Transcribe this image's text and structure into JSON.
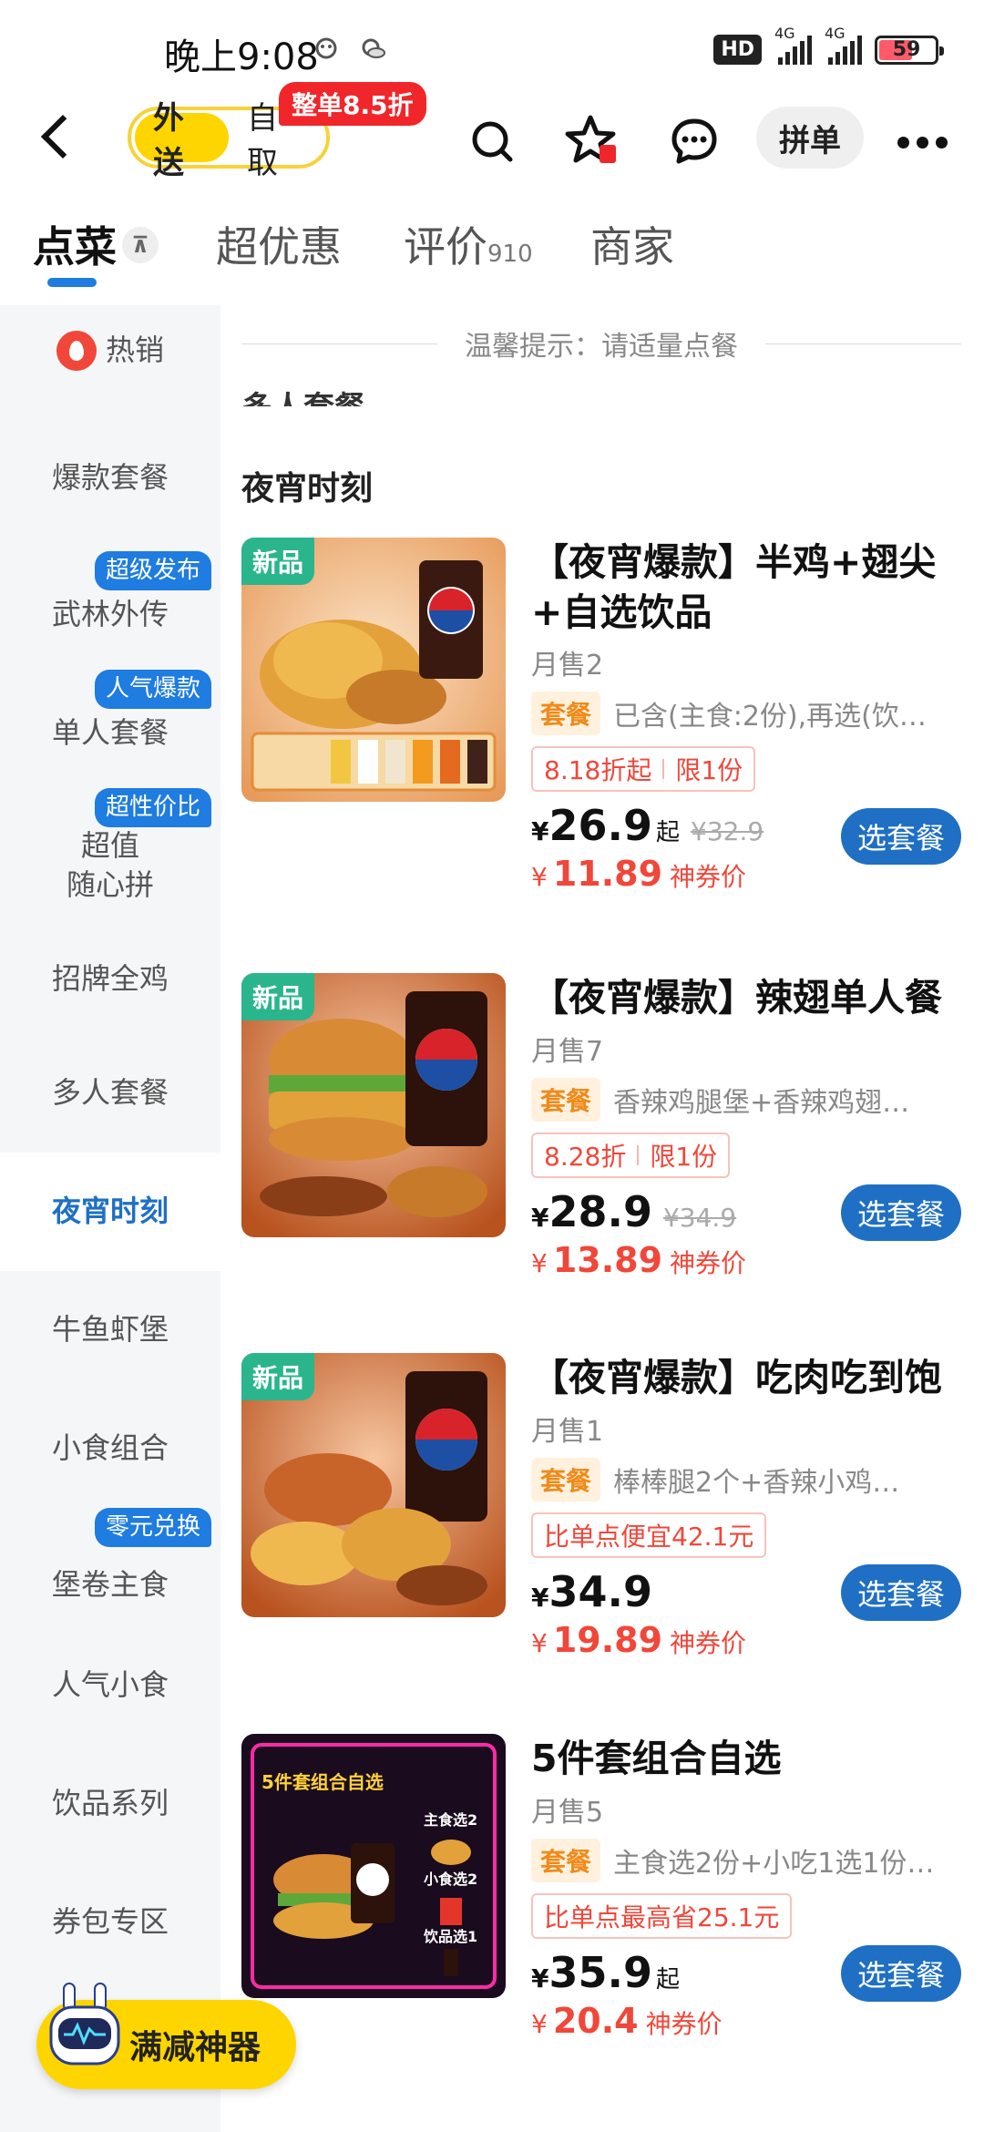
{
  "status_bar": {
    "time": "晚上9:08",
    "hd": "HD",
    "signal_1": "4G",
    "signal_2": "4G",
    "battery": "59"
  },
  "nav": {
    "delivery": "外送",
    "pickup": "自取",
    "promo_badge": "整单8.5折",
    "group_order": "拼单"
  },
  "tabs": [
    {
      "label": "点菜",
      "sub": ""
    },
    {
      "label": "超优惠",
      "sub": ""
    },
    {
      "label": "评价",
      "sub": "910"
    },
    {
      "label": "商家",
      "sub": ""
    }
  ],
  "sidebar": {
    "items": [
      {
        "label": "热销",
        "tag": ""
      },
      {
        "label": "爆款套餐",
        "tag": ""
      },
      {
        "label": "武林外传",
        "tag": "超级发布"
      },
      {
        "label": "单人套餐",
        "tag": "人气爆款"
      },
      {
        "label": "超值随心拼",
        "line1": "超值",
        "line2": "随心拼",
        "tag": "超性价比"
      },
      {
        "label": "招牌全鸡",
        "tag": ""
      },
      {
        "label": "多人套餐",
        "tag": ""
      },
      {
        "label": "夜宵时刻",
        "tag": ""
      },
      {
        "label": "牛鱼虾堡",
        "tag": ""
      },
      {
        "label": "小食组合",
        "tag": ""
      },
      {
        "label": "堡卷主食",
        "tag": "零元兑换"
      },
      {
        "label": "人气小食",
        "tag": ""
      },
      {
        "label": "饮品系列",
        "tag": ""
      },
      {
        "label": "券包专区",
        "tag": ""
      }
    ]
  },
  "main": {
    "notice": "温馨提示：请适量点餐",
    "cut_heading": "多人套餐",
    "section_title": "夜宵时刻",
    "products": [
      {
        "new_tag": "新品",
        "name": "【夜宵爆款】半鸡+翅尖+自选饮品",
        "sales": "月售2",
        "combo_tag": "套餐",
        "combo_desc": "已含(主食:2份),再选(饮…",
        "discount": "8.18折起",
        "limit": "限1份",
        "yen": "¥",
        "price": "26.9",
        "price_suffix": "起",
        "orig_price": "¥32.9",
        "coupon_price": "11.89",
        "coupon_label": "神券价",
        "button": "选套餐"
      },
      {
        "new_tag": "新品",
        "name": "【夜宵爆款】辣翅单人餐",
        "sales": "月售7",
        "combo_tag": "套餐",
        "combo_desc": "香辣鸡腿堡+香辣鸡翅…",
        "discount": "8.28折",
        "limit": "限1份",
        "yen": "¥",
        "price": "28.9",
        "price_suffix": "",
        "orig_price": "¥34.9",
        "coupon_price": "13.89",
        "coupon_label": "神券价",
        "button": "选套餐"
      },
      {
        "new_tag": "新品",
        "name": "【夜宵爆款】吃肉吃到饱",
        "sales": "月售1",
        "combo_tag": "套餐",
        "combo_desc": "棒棒腿2个+香辣小鸡…",
        "discount": "比单点便宜42.1元",
        "limit": "",
        "yen": "¥",
        "price": "34.9",
        "price_suffix": "",
        "orig_price": "",
        "coupon_price": "19.89",
        "coupon_label": "神券价",
        "button": "选套餐"
      },
      {
        "new_tag": "",
        "name": "5件套组合自选",
        "sales": "月售5",
        "combo_tag": "套餐",
        "combo_desc": "主食选2份+小吃1选1份…",
        "discount": "比单点最高省25.1元",
        "limit": "",
        "yen": "¥",
        "price": "35.9",
        "price_suffix": "起",
        "orig_price": "",
        "coupon_price": "20.4",
        "coupon_label": "神券价",
        "button": "选套餐",
        "image_text": {
          "title": "5件套组合自选",
          "l1": "主食选2",
          "l2": "小食选2",
          "l3": "饮品选1"
        }
      }
    ]
  },
  "float_button": {
    "label": "满减神器"
  },
  "colors": {
    "accent_blue": "#1f6fc4",
    "yellow": "#ffd500",
    "price_red": "#f0473a",
    "new_green": "#2bb58d"
  }
}
